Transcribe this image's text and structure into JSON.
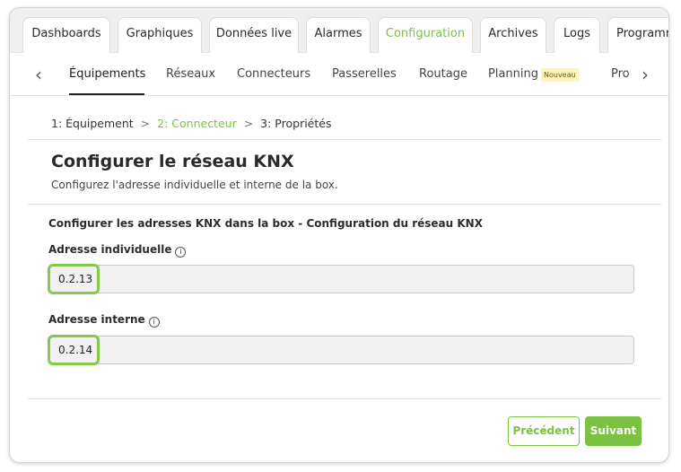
{
  "top_tabs": [
    {
      "label": "Dashboards"
    },
    {
      "label": "Graphiques"
    },
    {
      "label": "Données live"
    },
    {
      "label": "Alarmes"
    },
    {
      "label": "Configuration",
      "active": true
    },
    {
      "label": "Archives"
    },
    {
      "label": "Logs"
    },
    {
      "label": "Programm"
    }
  ],
  "subnav": {
    "items": [
      {
        "label": "Équipements",
        "active": true
      },
      {
        "label": "Réseaux"
      },
      {
        "label": "Connecteurs"
      },
      {
        "label": "Passerelles"
      },
      {
        "label": "Routage"
      },
      {
        "label": "Planning"
      },
      {
        "label": "Pro"
      }
    ],
    "badge": "Nouveau",
    "prev_icon": "‹",
    "next_icon": "›"
  },
  "breadcrumb": {
    "step1": "1:  Équipement",
    "sep1": ">",
    "step2": "2:  Connecteur",
    "sep2": ">",
    "step3": "3:  Propriétés"
  },
  "header": {
    "title": "Configurer le réseau KNX",
    "description": "Configurez l'adresse individuelle et interne de la box."
  },
  "form": {
    "section_title": "Configurer les adresses KNX dans la box - Configuration du réseau KNX",
    "individual_label": "Adresse individuelle",
    "individual_value": "0.2.13",
    "internal_label": "Adresse interne",
    "internal_value": "0.2.14",
    "info_icon": "i"
  },
  "actions": {
    "previous": "Précédent",
    "next": "Suivant"
  },
  "colors": {
    "accent": "#7cc242",
    "highlight": "#86c94a",
    "badge_bg": "#fcf4bf"
  }
}
